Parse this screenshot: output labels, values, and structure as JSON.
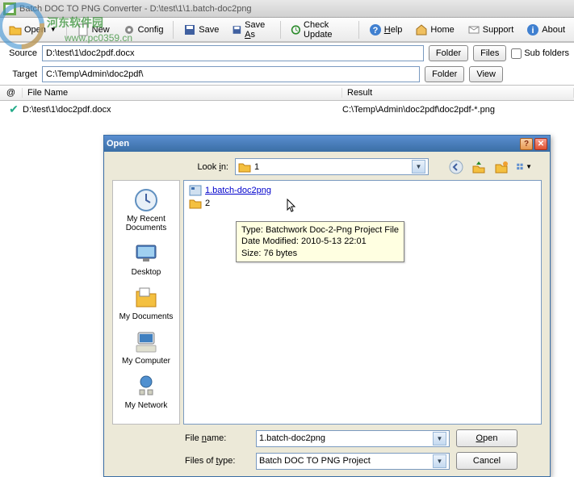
{
  "window": {
    "title": "Batch DOC TO PNG Converter - D:\\test\\1\\1.batch-doc2png"
  },
  "watermark": {
    "line1": "河东软件园",
    "line2": "www.pc0359.cn"
  },
  "toolbar": {
    "open": "Open",
    "new": "New",
    "config": "Config",
    "save": "Save",
    "saveas": "Save As",
    "check": "Check Update",
    "help": "Help",
    "home": "Home",
    "support": "Support",
    "about": "About"
  },
  "paths": {
    "source_lbl": "Source",
    "source_val": "D:\\test\\1\\doc2pdf.docx",
    "target_lbl": "Target",
    "target_val": "C:\\Temp\\Admin\\doc2pdf\\",
    "folder_btn": "Folder",
    "files_btn": "Files",
    "view_btn": "View",
    "subfolders": "Sub folders"
  },
  "list": {
    "col_at": "@",
    "col_file": "File Name",
    "col_result": "Result",
    "row_file": "D:\\test\\1\\doc2pdf.docx",
    "row_result": "C:\\Temp\\Admin\\doc2pdf\\doc2pdf-*.png"
  },
  "dialog": {
    "title": "Open",
    "lookin_lbl": "Look in:",
    "lookin_val": "1",
    "places": {
      "recent": "My Recent Documents",
      "desktop": "Desktop",
      "mydocs": "My Documents",
      "mycomp": "My Computer",
      "mynet": "My Network"
    },
    "files": {
      "item1": "1.batch-doc2png",
      "item2": "2"
    },
    "tooltip": {
      "type": "Type: Batchwork Doc-2-Png Project File",
      "date": "Date Modified: 2010-5-13 22:01",
      "size": "Size: 76 bytes"
    },
    "filename_lbl": "File name:",
    "filename_val": "1.batch-doc2png",
    "filetype_lbl": "Files of type:",
    "filetype_val": "Batch DOC TO PNG Project",
    "open_btn": "Open",
    "cancel_btn": "Cancel"
  }
}
